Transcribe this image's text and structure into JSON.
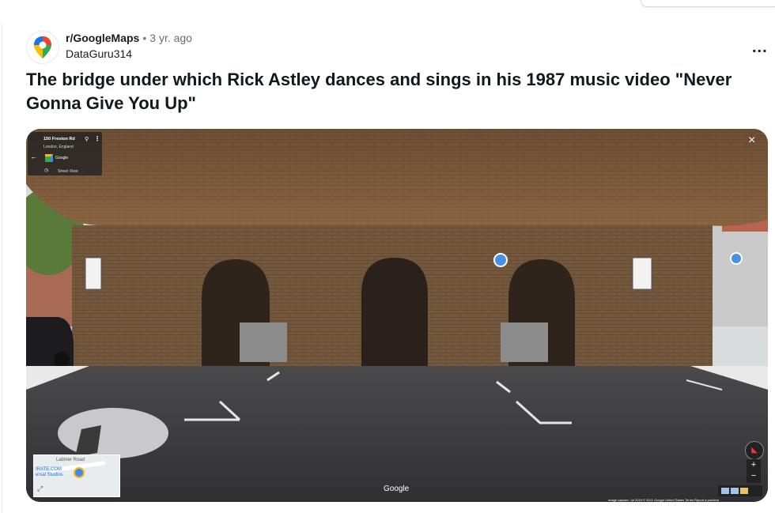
{
  "post": {
    "subreddit": "r/GoogleMaps",
    "separator": "•",
    "age": "3 yr. ago",
    "author": "DataGuru314",
    "more_label": "...",
    "title": "The bridge under which Rick Astley dances and sings in his 1987 music video \"Never Gonna Give You Up\""
  },
  "streetview": {
    "address": "150 Freston Rd",
    "city": "London, England",
    "brand": "Google",
    "mode": "Street View",
    "close_label": "×",
    "watermark": "Google",
    "footer": "Image capture: Jul 2019   © 2021 Google   United States   Terms   Report a problem",
    "minimap": {
      "road_label": "Latimer Road",
      "place_label_1": "IRATE.COM",
      "place_label_2": "ersal Studios"
    },
    "zoom_in": "+",
    "zoom_out": "−"
  },
  "colors": {
    "brick": "#7a5a3c",
    "sky": "#dfe3e5",
    "road": "#3d3d3f"
  }
}
